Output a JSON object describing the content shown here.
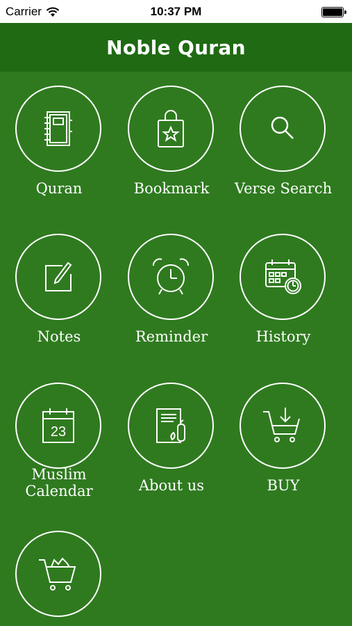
{
  "status_bar": {
    "carrier": "Carrier",
    "time": "10:37 PM"
  },
  "header": {
    "title": "Noble Quran"
  },
  "menu": [
    {
      "label": "Quran",
      "icon": "notebook-icon"
    },
    {
      "label": "Bookmark",
      "icon": "shopping-bag-star-icon"
    },
    {
      "label": "Verse Search",
      "icon": "search-icon"
    },
    {
      "label": "Notes",
      "icon": "edit-note-icon"
    },
    {
      "label": "Reminder",
      "icon": "alarm-clock-icon"
    },
    {
      "label": "History",
      "icon": "calendar-clock-icon"
    },
    {
      "label_line1": "Muslim",
      "label_line2": "Calendar",
      "icon": "calendar-icon",
      "date_number": "23"
    },
    {
      "label": "About us",
      "icon": "document-icon"
    },
    {
      "label": "BUY",
      "icon": "cart-download-icon"
    },
    {
      "label": "",
      "icon": "cart-full-icon"
    }
  ],
  "colors": {
    "background": "#2f7a1f",
    "header": "#1f6a12",
    "foreground": "#ffffff"
  }
}
